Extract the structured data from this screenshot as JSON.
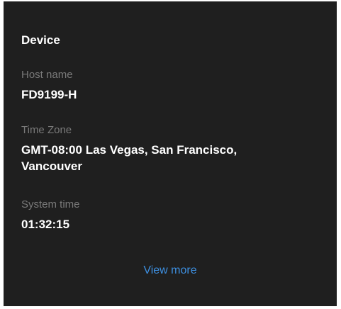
{
  "card": {
    "title": "Device",
    "fields": [
      {
        "label": "Host name",
        "value": "FD9199-H"
      },
      {
        "label": "Time Zone",
        "value_line1": "GMT-08:00 Las Vegas, San Francisco,",
        "value_line2": "Vancouver"
      },
      {
        "label": "System time",
        "value": "01:32:15"
      }
    ],
    "link_label": "View more"
  },
  "colors": {
    "card_bg": "#1f1f1f",
    "label_text": "#7a7a7a",
    "value_text": "#ffffff",
    "link": "#3d8fe0"
  }
}
